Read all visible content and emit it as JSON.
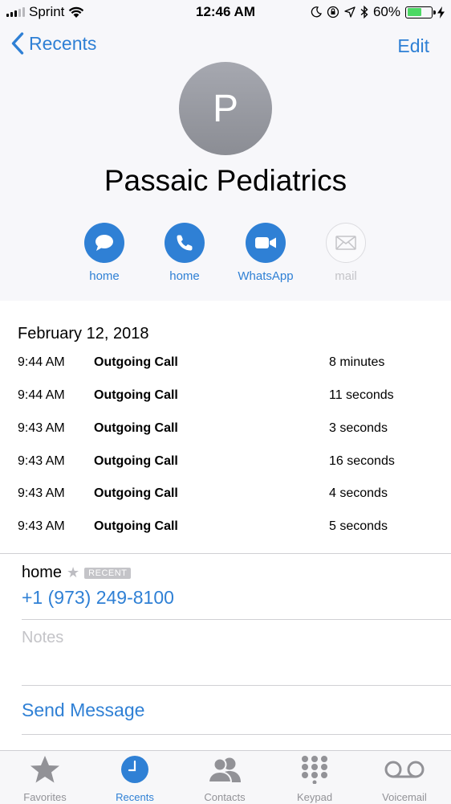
{
  "status_bar": {
    "carrier": "Sprint",
    "time": "12:46 AM",
    "battery_percent": "60%",
    "battery_level": 0.6,
    "icons": [
      "signal-icon",
      "wifi-icon",
      "moon-icon",
      "rotation-lock-icon",
      "location-icon",
      "bluetooth-icon",
      "battery-icon",
      "charging-icon"
    ]
  },
  "nav": {
    "back_label": "Recents",
    "edit_label": "Edit"
  },
  "contact": {
    "initial": "P",
    "name": "Passaic Pediatrics"
  },
  "actions": [
    {
      "label": "home",
      "icon": "message-icon",
      "enabled": true
    },
    {
      "label": "home",
      "icon": "phone-icon",
      "enabled": true
    },
    {
      "label": "WhatsApp",
      "icon": "video-icon",
      "enabled": true
    },
    {
      "label": "mail",
      "icon": "mail-icon",
      "enabled": false
    }
  ],
  "recents": {
    "date": "February 12, 2018",
    "calls": [
      {
        "time": "9:44 AM",
        "type": "Outgoing Call",
        "duration": "8 minutes"
      },
      {
        "time": "9:44 AM",
        "type": "Outgoing Call",
        "duration": "11 seconds"
      },
      {
        "time": "9:43 AM",
        "type": "Outgoing Call",
        "duration": "3 seconds"
      },
      {
        "time": "9:43 AM",
        "type": "Outgoing Call",
        "duration": "16 seconds"
      },
      {
        "time": "9:43 AM",
        "type": "Outgoing Call",
        "duration": "4 seconds"
      },
      {
        "time": "9:43 AM",
        "type": "Outgoing Call",
        "duration": "5 seconds"
      }
    ]
  },
  "phone": {
    "label": "home",
    "badge": "RECENT",
    "number": "+1 (973) 249-8100"
  },
  "notes_placeholder": "Notes",
  "send_message_label": "Send Message",
  "tabs": [
    {
      "label": "Favorites",
      "icon": "star-icon",
      "active": false
    },
    {
      "label": "Recents",
      "icon": "clock-icon",
      "active": true
    },
    {
      "label": "Contacts",
      "icon": "contacts-icon",
      "active": false
    },
    {
      "label": "Keypad",
      "icon": "keypad-icon",
      "active": false
    },
    {
      "label": "Voicemail",
      "icon": "voicemail-icon",
      "active": false
    }
  ],
  "colors": {
    "accent": "#2f80d5",
    "battery": "#4cd964",
    "header_bg": "#f7f7fa",
    "disabled": "#c4c4c8"
  }
}
